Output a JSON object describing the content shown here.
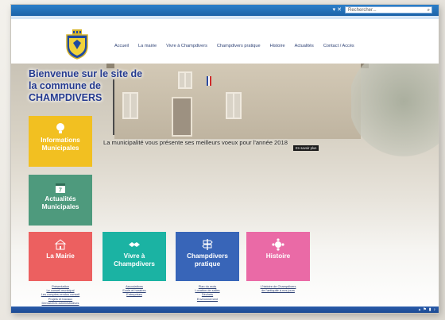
{
  "browser": {
    "search_placeholder": "Rechercher..."
  },
  "nav": {
    "items": [
      "Accueil",
      "La mairie",
      "Vivre à Champdivers",
      "Champdivers pratique",
      "Histoire",
      "Actualités",
      "Contact / Accès"
    ]
  },
  "hero": {
    "welcome": "Bienvenue sur le site de la commune de CHAMPDIVERS",
    "banner_text": "La municipalité vous présente ses meilleurs voeux pour l'année 2018",
    "more_button": "En savoir plus"
  },
  "tiles": {
    "info": "Informations Municipales",
    "news": "Actualités Municipales",
    "mairie": "La Mairie",
    "vivre": "Vivre à Champdivers",
    "pratique": "Champdivers pratique",
    "histoire": "Histoire"
  },
  "links": {
    "mairie": [
      "Présentation",
      "Le conseil municipal",
      "Les comptes-rendus conseil",
      "Projets et travaux",
      "Démarches administratives"
    ],
    "vivre": [
      "Associations",
      "Ecole et horaires",
      "Entreprises"
    ],
    "pratique": [
      "Plan du mois",
      "Location de salles",
      "Déchets",
      "Environnement"
    ],
    "histoire": [
      "L'histoire de Champdivers",
      "de l'antiquité à nos jours"
    ]
  },
  "colors": {
    "info": "#f2c021",
    "news": "#4e9a7d",
    "mairie": "#ec6060",
    "vivre": "#1bb3a3",
    "pratique": "#3865b8",
    "histoire": "#ea6aa6",
    "title_blue": "#243a8f"
  }
}
